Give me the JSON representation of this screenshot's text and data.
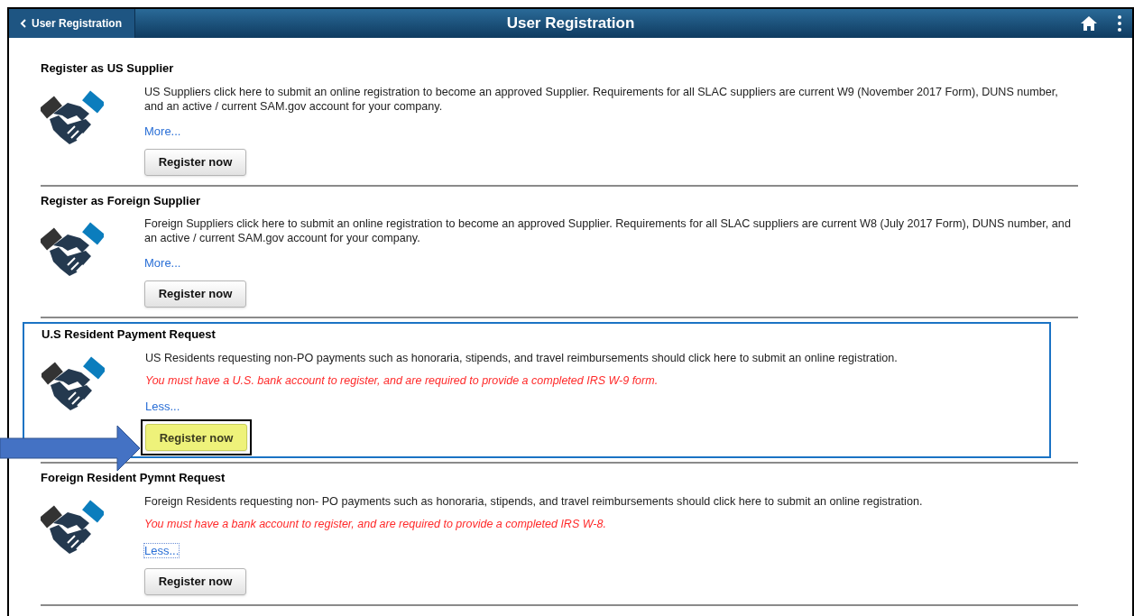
{
  "header": {
    "back_label": "User Registration",
    "title": "User Registration"
  },
  "sections": [
    {
      "title": "Register as US Supplier",
      "description": "US Suppliers click here to submit an online registration to become an approved Supplier. Requirements for all SLAC suppliers are current W9 (November 2017 Form), DUNS number, and an active / current SAM.gov account for your company.",
      "toggle": {
        "label": "More...",
        "focused": false
      },
      "button": {
        "label": "Register now",
        "highlighted": false
      },
      "highlighted": false
    },
    {
      "title": "Register as Foreign Supplier",
      "description": "Foreign Suppliers click here to submit an online registration to become an approved Supplier. Requirements for all SLAC suppliers are current W8 (July 2017 Form), DUNS number, and an active / current SAM.gov account for your company.",
      "toggle": {
        "label": "More...",
        "focused": false
      },
      "button": {
        "label": "Register now",
        "highlighted": false
      },
      "highlighted": false
    },
    {
      "title": "U.S Resident Payment Request",
      "description": "US Residents requesting non-PO payments such as honoraria, stipends, and travel reimbursements should click here to submit an online registration.",
      "warning": "You must have a U.S. bank account to register, and are required to provide a completed IRS W-9 form.",
      "toggle": {
        "label": "Less...",
        "focused": false
      },
      "button": {
        "label": "Register now",
        "highlighted": true
      },
      "highlighted": true
    },
    {
      "title": "Foreign Resident Pymnt Request",
      "description": "Foreign Residents requesting non- PO payments such as honoraria, stipends, and travel reimbursements should click here to submit an online registration.",
      "warning": "You must have a bank account to register, and are required to provide a completed IRS W-8.",
      "toggle": {
        "label": "Less...",
        "focused": true
      },
      "button": {
        "label": "Register now",
        "highlighted": false
      },
      "highlighted": false
    }
  ]
}
